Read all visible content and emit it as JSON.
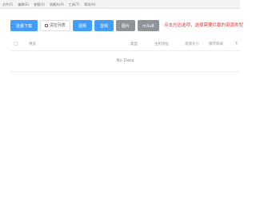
{
  "menubar": {
    "items": [
      "文件(F)",
      "编辑(E)",
      "查看(V)",
      "收藏夹(A)",
      "工具(T)",
      "帮助(H)"
    ]
  },
  "toolbar": {
    "batch_download": "批量下载",
    "clear_list": "清空列表",
    "video": "视频",
    "audio": "音频",
    "image": "图片",
    "m3u8": "m3u8",
    "hint": "点击左边选项，选择需要拦截的资源类型"
  },
  "table": {
    "headers": [
      "预览",
      "类型",
      "主机地址",
      "资源大小",
      "保存目录",
      "下"
    ],
    "empty_text": "No Data"
  }
}
